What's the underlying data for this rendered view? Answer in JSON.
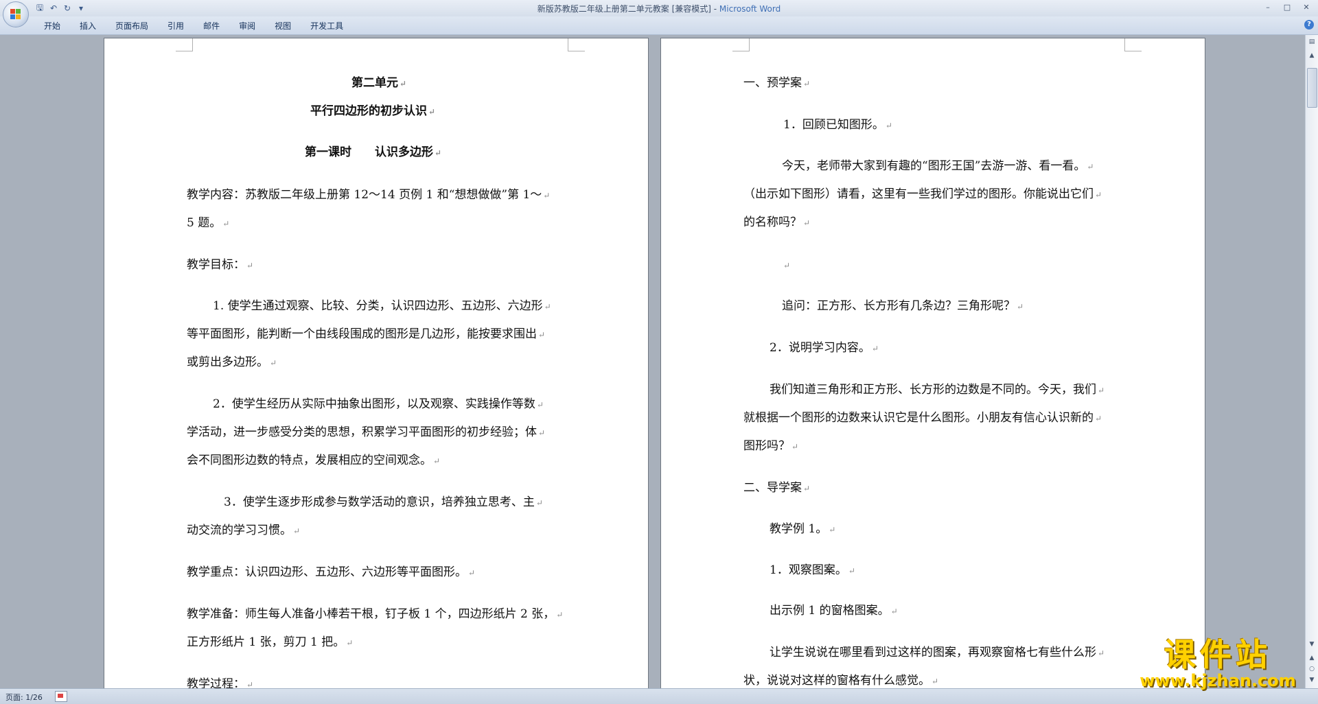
{
  "window": {
    "title": "新版苏教版二年级上册第二单元教案 [兼容模式] - ",
    "app_name": "Microsoft Word"
  },
  "quick_access": [
    "save-icon",
    "undo-icon",
    "redo-icon",
    "customize-icon"
  ],
  "ribbon_tabs": [
    "开始",
    "插入",
    "页面布局",
    "引用",
    "邮件",
    "审阅",
    "视图",
    "开发工具"
  ],
  "status": {
    "page": "页面: 1/26"
  },
  "watermark": {
    "main": "课件站",
    "url": "www.kjzhan.com"
  },
  "page1": [
    {
      "text": "第二单元",
      "bold": true
    },
    {
      "text": "平行四边形的初步认识",
      "bold": true
    },
    {
      "text": "第一课时　　认识多边形",
      "bold": true
    },
    {
      "text": "教学内容：苏教版二年级上册第 12～14 页例 1 和“想想做做”第 1～"
    },
    {
      "text": "5 题。"
    },
    {
      "text": "教学目标："
    },
    {
      "text": "1. 使学生通过观察、比较、分类，认识四边形、五边形、六边形"
    },
    {
      "text": "等平面图形，能判断一个由线段围成的图形是几边形，能按要求围出"
    },
    {
      "text": "或剪出多边形。"
    },
    {
      "text": "2．使学生经历从实际中抽象出图形，以及观察、实践操作等数"
    },
    {
      "text": "学活动，进一步感受分类的思想，积累学习平面图形的初步经验；体"
    },
    {
      "text": "会不同图形边数的特点，发展相应的空间观念。"
    },
    {
      "text": "3．使学生逐步形成参与数学活动的意识，培养独立思考、主"
    },
    {
      "text": "动交流的学习习惯。"
    },
    {
      "text": "教学重点：认识四边形、五边形、六边形等平面图形。"
    },
    {
      "text": "教学准备：师生每人准备小棒若干根，钉子板 1 个，四边形纸片 2 张，"
    },
    {
      "text": "正方形纸片 1 张，剪刀 1 把。"
    },
    {
      "text": "教学过程："
    }
  ],
  "page2": [
    {
      "text": "一、预学案"
    },
    {
      "text": "1．回顾已知图形。"
    },
    {
      "text": "今天，老师带大家到有趣的“图形王国”去游一游、看一看。"
    },
    {
      "text": "（出示如下图形）请看，这里有一些我们学过的图形。你能说出它们"
    },
    {
      "text": "的名称吗？"
    },
    {
      "text": ""
    },
    {
      "text": "追问：正方形、长方形有几条边？三角形呢？"
    },
    {
      "text": "2．说明学习内容。"
    },
    {
      "text": "我们知道三角形和正方形、长方形的边数是不同的。今天，我们"
    },
    {
      "text": "就根据一个图形的边数来认识它是什么图形。小朋友有信心认识新的"
    },
    {
      "text": "图形吗？"
    },
    {
      "text": "二、导学案"
    },
    {
      "text": "教学例 1。"
    },
    {
      "text": "1．观察图案。"
    },
    {
      "text": "出示例 1 的窗格图案。"
    },
    {
      "text": "让学生说说在哪里看到过这样的图案，再观察窗格七有些什么形"
    },
    {
      "text": "状，说说对这样的窗格有什么感觉。"
    }
  ]
}
